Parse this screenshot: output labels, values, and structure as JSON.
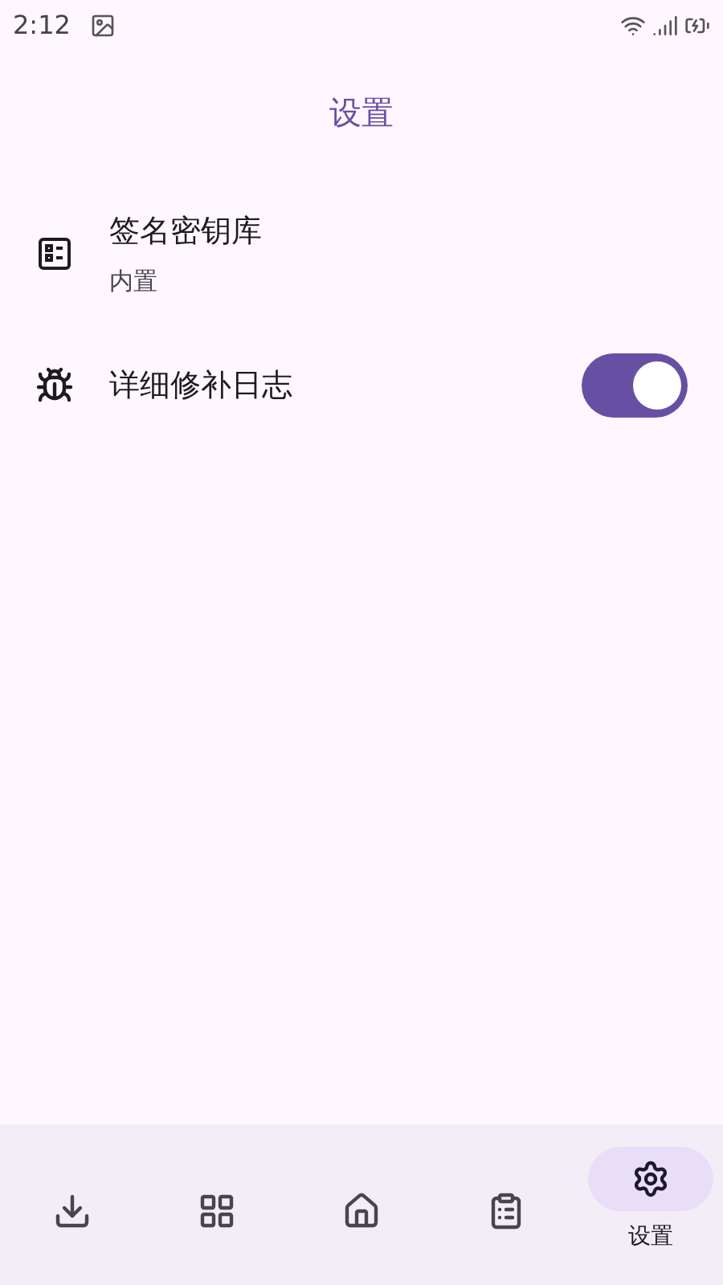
{
  "status_bar": {
    "time": "2:12"
  },
  "title": "设置",
  "settings": [
    {
      "kind": "link",
      "title": "签名密钥库",
      "subtitle": "内置"
    },
    {
      "kind": "toggle",
      "title": "详细修补日志",
      "on": true
    }
  ],
  "nav": [
    {
      "selected": false
    },
    {
      "selected": false
    },
    {
      "selected": false
    },
    {
      "selected": false
    },
    {
      "selected": true,
      "label": "设置"
    }
  ]
}
